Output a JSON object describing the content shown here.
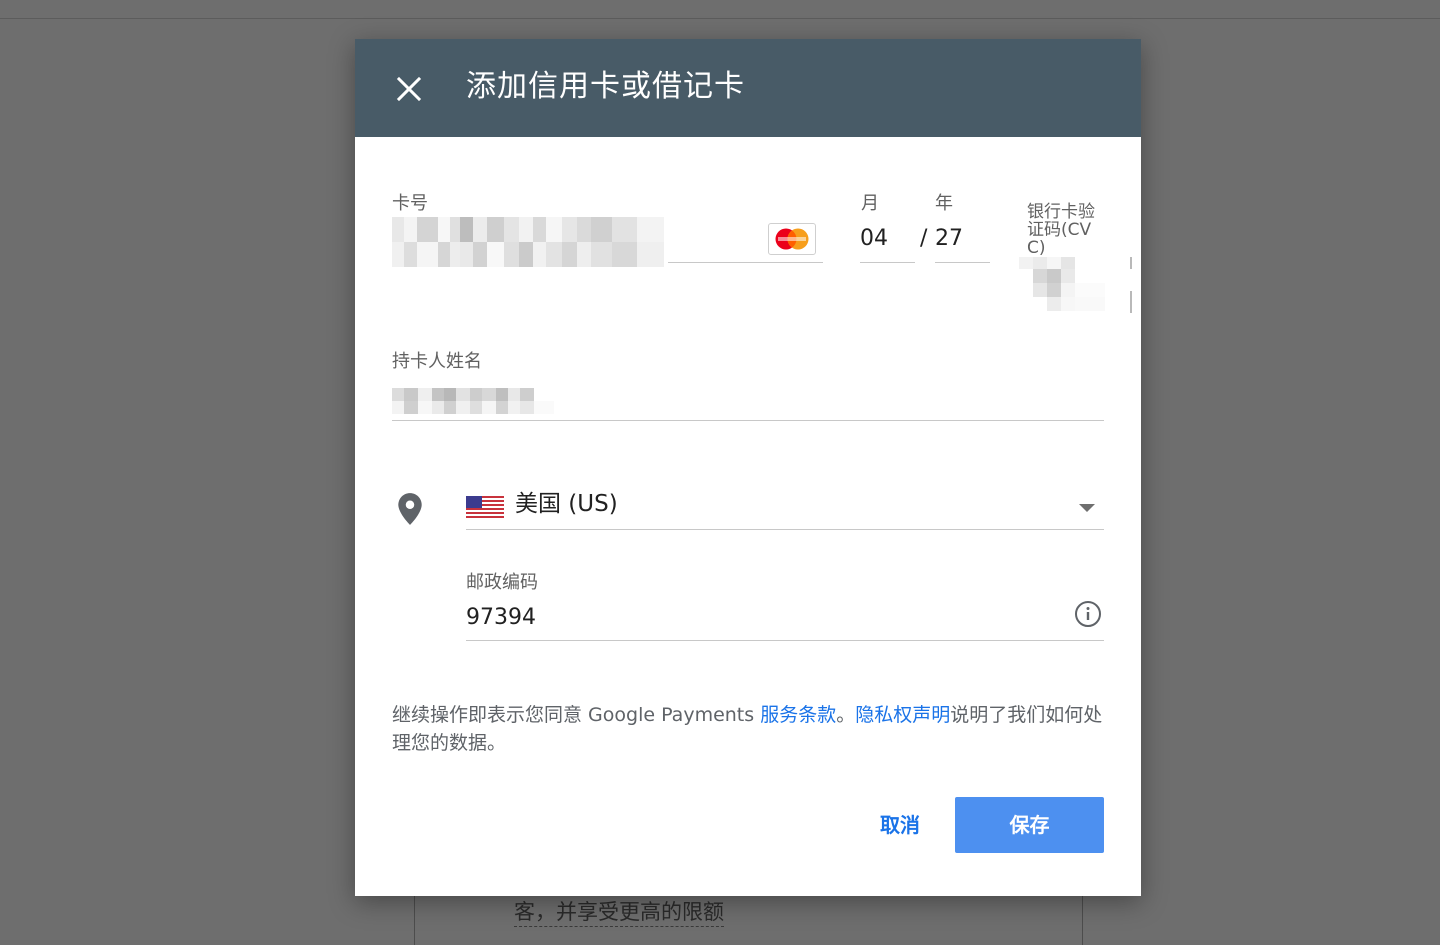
{
  "dialog": {
    "title": "添加信用卡或借记卡"
  },
  "card": {
    "number_label": "卡号",
    "month_label": "月",
    "year_label": "年",
    "month_value": "04",
    "year_separator": "/",
    "year_value": "27",
    "cvc_label": "银行卡验证码(CVC)"
  },
  "cardholder": {
    "label": "持卡人姓名"
  },
  "address": {
    "country": "美国 (US)",
    "postal_label": "邮政编码",
    "postal_value": "97394"
  },
  "consent": {
    "prefix": "继续操作即表示您同意 Google Payments ",
    "terms_link": "服务条款",
    "mid": "。",
    "privacy_link": "隐私权声明",
    "suffix": "说明了我们如何处理您的数据。"
  },
  "actions": {
    "cancel": "取消",
    "save": "保存"
  },
  "background": {
    "text": "客，并享受更高的限额"
  },
  "colors": {
    "header": "#485b67",
    "link": "#1a73e8",
    "save_button": "#4d90f0"
  },
  "icons": {
    "close": "close-icon",
    "location": "location-pin-icon",
    "info": "info-icon",
    "dropdown": "chevron-down-icon",
    "card_brand": "mastercard-icon",
    "flag": "us-flag-icon"
  }
}
